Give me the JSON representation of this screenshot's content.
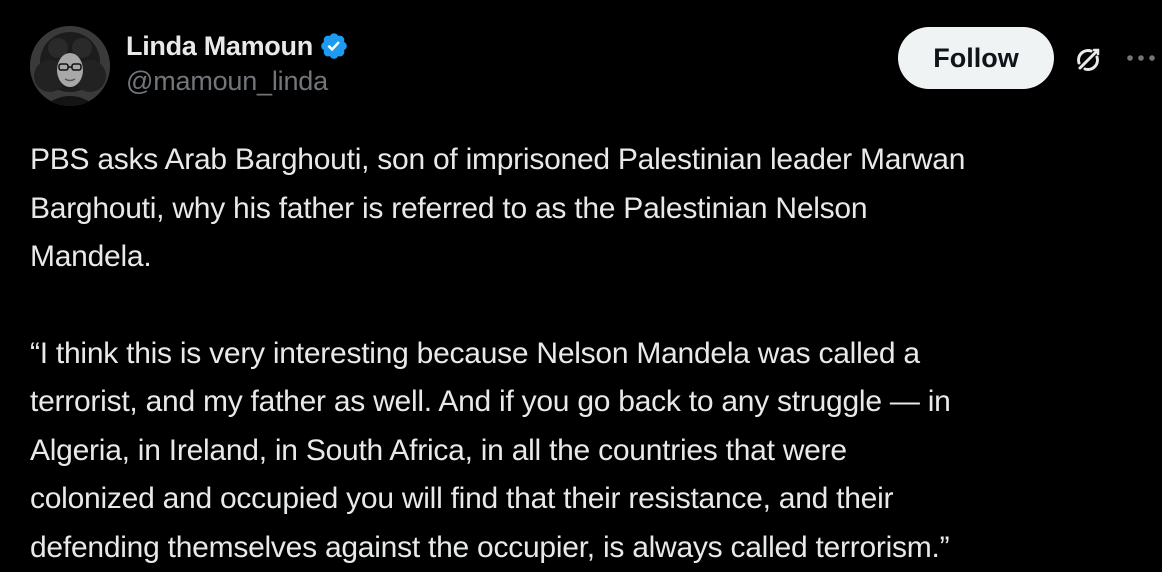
{
  "author": {
    "display_name": "Linda Mamoun",
    "handle": "@mamoun_linda",
    "verified": true,
    "avatar_icon": "profile-photo"
  },
  "actions": {
    "follow_label": "Follow",
    "grok_icon": "grok-icon",
    "more_icon": "more-options-icon"
  },
  "post": {
    "paragraph_1": "PBS asks Arab Barghouti, son of imprisoned Palestinian leader Marwan\nBarghouti, why his father is referred to as the Palestinian Nelson\nMandela.",
    "paragraph_2": "“I think this is very interesting because Nelson Mandela was called a\nterrorist, and my father as well. And if you go back to any struggle — in\nAlgeria, in Ireland, in South Africa, in all the countries that were\ncolonized and occupied you will find that their resistance, and their\ndefending themselves against the occupier, is always called terrorism.”"
  },
  "colors": {
    "background": "#000000",
    "text_primary": "#e7e9ea",
    "text_secondary": "#71767b",
    "verified_blue": "#1d9bf0",
    "follow_bg": "#eff3f4"
  }
}
